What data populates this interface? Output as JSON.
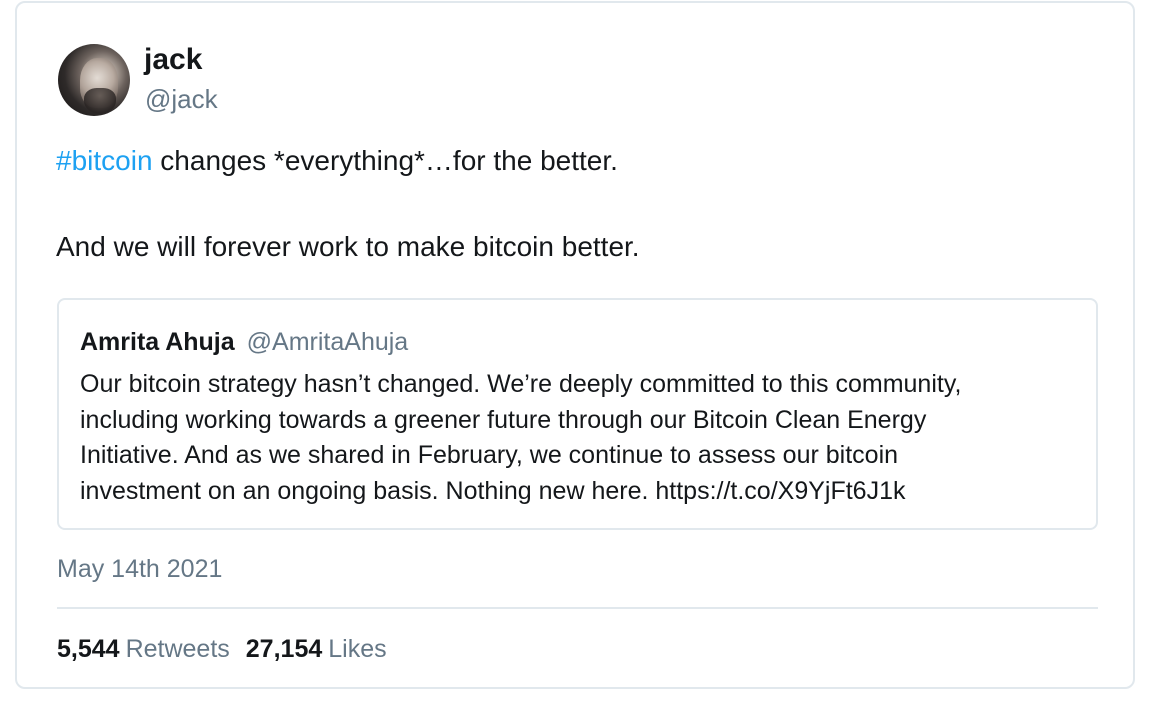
{
  "author": {
    "name": "jack",
    "handle": "@jack",
    "avatar_icon": "profile-photo"
  },
  "tweet": {
    "hashtag": "#bitcoin",
    "line1_rest": " changes *everything*…for the better.",
    "line2": "And we will forever work to make bitcoin better."
  },
  "quoted_tweet": {
    "name": "Amrita Ahuja",
    "handle": "@AmritaAhuja",
    "lines": [
      "Our bitcoin strategy hasn’t changed. We’re deeply committed to this community,",
      "including working towards a greener future through our Bitcoin Clean Energy",
      "Initiative. And as we shared in February, we continue to assess our bitcoin",
      "investment on an ongoing basis. Nothing new here. https://t.co/X9YjFt6J1k"
    ]
  },
  "date": "May 14th 2021",
  "stats": {
    "retweets_count": "5,544",
    "retweets_label": "Retweets",
    "likes_count": "27,154",
    "likes_label": "Likes"
  },
  "colors": {
    "hashtag": "#1da1f2",
    "secondary_text": "#657786",
    "border": "#e1e8ed"
  }
}
